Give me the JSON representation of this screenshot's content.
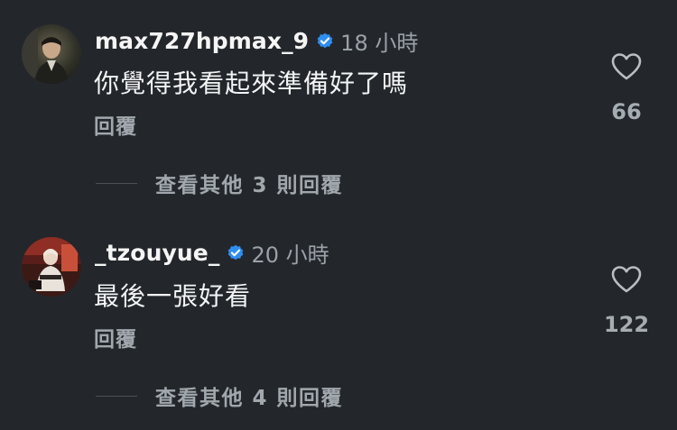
{
  "comments": [
    {
      "username": "max727hpmax_9",
      "time": "18 小時",
      "text": "你覺得我看起來準備好了嗎",
      "reply_label": "回覆",
      "like_count": "66",
      "more_replies": "查看其他 3 則回覆",
      "verified_color": "#2f8ef2",
      "icons": [
        "avatar",
        "verified-badge-icon",
        "heart-icon"
      ]
    },
    {
      "username": "_tzouyue_",
      "time": "20 小時",
      "text": "最後一張好看",
      "reply_label": "回覆",
      "like_count": "122",
      "more_replies": "查看其他 4 則回覆",
      "verified_color": "#2f8ef2",
      "icons": [
        "avatar",
        "verified-badge-icon",
        "heart-icon"
      ]
    }
  ],
  "theme": {
    "background": "#23272b",
    "primary_text": "#f2f4f5",
    "secondary_text": "#9aa1a8"
  }
}
